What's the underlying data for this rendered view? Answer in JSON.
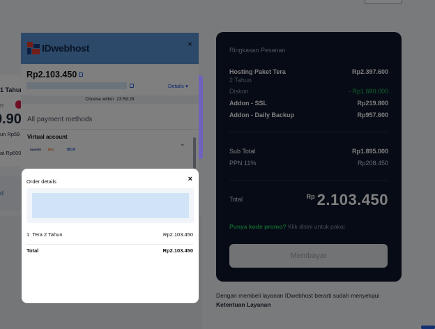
{
  "background": {
    "left_card": {
      "plan": "1 Tahun",
      "badge_prefix": "n",
      "price_partial": "9.90",
      "line1": "un Rp59",
      "line2": "at Rp600",
      "strip_text": "d"
    },
    "summary": {
      "title": "Ringkasan Pesanan",
      "items": [
        {
          "label": "Hosting Paket Tera",
          "value": "Rp2.397.600",
          "style": "bold"
        },
        {
          "label": "2 Tahun",
          "value": "",
          "style": "muted"
        },
        {
          "label": "Diskon",
          "value": "- Rp1.680.000",
          "style": "discount"
        },
        {
          "label": "Addon - SSL",
          "value": "Rp219.800",
          "style": "bold"
        },
        {
          "label": "Addon - Daily Backup",
          "value": "Rp957.600",
          "style": "bold"
        }
      ],
      "subtotal_label": "Sub Total",
      "subtotal_value": "Rp1.895.000",
      "tax_label": "PPN 11%",
      "tax_value": "Rp208.450",
      "total_label": "Total",
      "total_currency": "Rp",
      "total_value": "2.103.450",
      "promo_link": "Punya kode promo?",
      "promo_text": "Klik disini untuk pakai",
      "pay_button": "Membayar"
    },
    "terms_text": "Dengan membeli layanan IDwebhost berarti sudah menyetujui",
    "terms_link": "Ketentuan Layanan"
  },
  "payment_popup": {
    "logo_text": "IDwebhost",
    "close": "×",
    "amount": "Rp2.103.450",
    "details_link": "Details ▾",
    "timer_label": "Choose within",
    "timer_value": "23:59:29",
    "all_methods": "All payment methods",
    "virtual_account": "Virtual account",
    "banks": [
      "mandiri",
      "BNI",
      "BCA"
    ],
    "colors": {
      "header": "#5b93d3",
      "accent": "#2563eb"
    }
  },
  "order_details": {
    "title": "Order details",
    "close": "×",
    "item_label": "Tera 2 Tahun",
    "item_prefix": "1",
    "item_value": "Rp2.103.450",
    "total_label": "Total",
    "total_value": "Rp2.103.450"
  }
}
